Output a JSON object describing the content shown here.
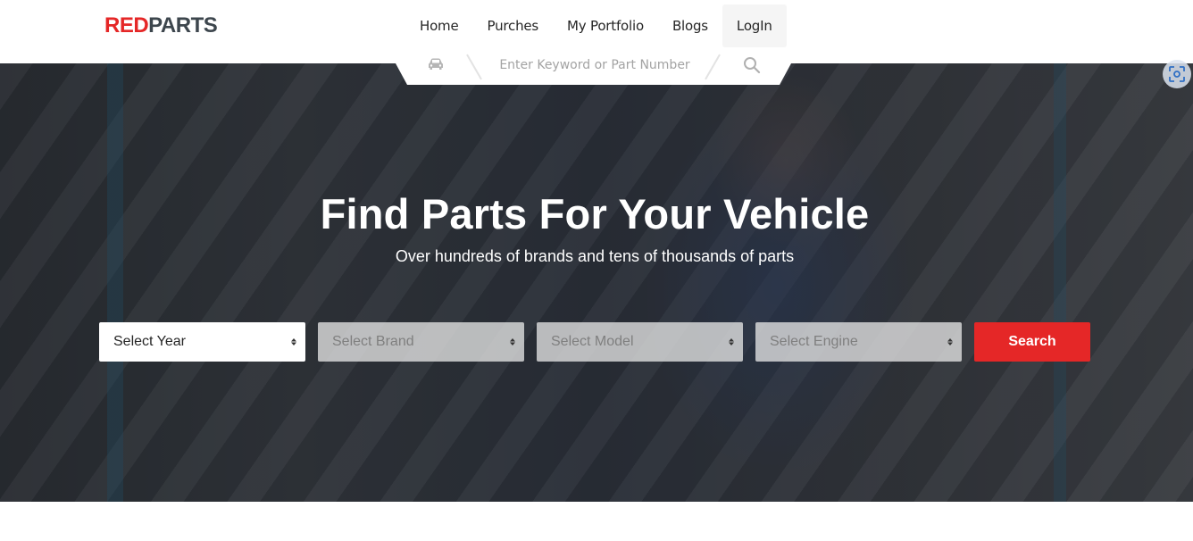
{
  "logo": {
    "part1": "RED",
    "part2": "PARTS"
  },
  "nav": {
    "items": [
      {
        "label": "Home"
      },
      {
        "label": "Purches"
      },
      {
        "label": "My Portfolio"
      },
      {
        "label": "Blogs"
      },
      {
        "label": "LogIn"
      }
    ]
  },
  "search": {
    "placeholder": "Enter Keyword or Part Number"
  },
  "hero": {
    "title": "Find Parts For Your Vehicle",
    "subtitle": "Over hundreds of brands and tens of thousands of parts"
  },
  "finder": {
    "year": "Select Year",
    "brand": "Select Brand",
    "model": "Select Model",
    "engine": "Select Engine",
    "search_label": "Search"
  },
  "colors": {
    "brand_red": "#e52727",
    "logo_dark": "#3d464d"
  },
  "icons": [
    "car-icon",
    "magnifier-icon",
    "scan-icon",
    "select-arrows-icon"
  ]
}
